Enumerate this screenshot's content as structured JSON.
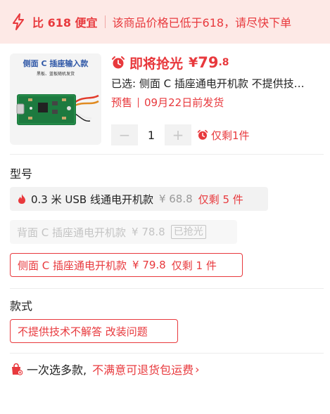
{
  "banner": {
    "icon": "lightning-icon",
    "title": "比 618 便宜",
    "message": "该商品价格已低于618，请尽快下单",
    "color": "#e8393d",
    "background": "#fde9e6"
  },
  "product": {
    "thumbnail_title": "侧面 C 插座输入款",
    "thumbnail_subtitle": "黑板、蓝板随机发货",
    "flash_label": "即将抢光",
    "currency": "¥",
    "price_int": "79",
    "price_dec": ".8",
    "selected_text": "已选: 侧面 C 插座通电开机款 不提供技术不解答 改装问题",
    "presale_label": "预售",
    "ship_text": "09月22日前发货",
    "quantity": "1",
    "minus_label": "−",
    "plus_label": "+",
    "remaining": "仅剩1件"
  },
  "model_section": {
    "title": "型号",
    "options": [
      {
        "label": "0.3 米 USB 线通电开机款",
        "price": "¥ 68.8",
        "stock": "仅剩 5 件",
        "state": "available",
        "hot": true
      },
      {
        "label": "背面 C 插座通电开机款",
        "price": "¥ 78.8",
        "stock": "已抢光",
        "state": "sold-out"
      },
      {
        "label": "侧面 C 插座通电开机款",
        "price": "¥ 79.8",
        "stock": "仅剩 1 件",
        "state": "selected"
      }
    ]
  },
  "style_section": {
    "title": "款式",
    "options": [
      {
        "label": "不提供技术不解答 改装问题",
        "state": "selected"
      }
    ]
  },
  "footer": {
    "lead": "一次选多款,",
    "link": "不满意可退货包运费",
    "arrow": "›"
  },
  "colors": {
    "accent": "#e8393d",
    "muted": "#999999",
    "chip_bg": "#f2f2f2"
  }
}
